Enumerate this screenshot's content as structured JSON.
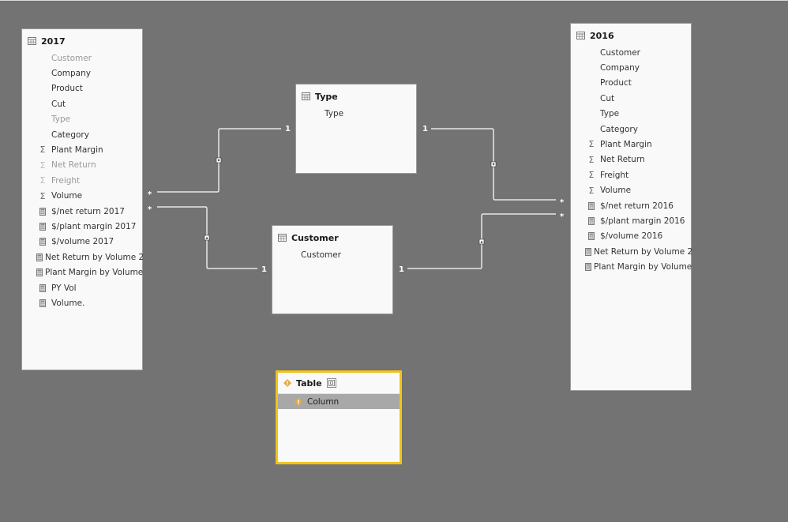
{
  "tables": {
    "t2017": {
      "title": "2017",
      "fields": [
        {
          "label": "Customer",
          "kind": "column",
          "hidden": true
        },
        {
          "label": "Company",
          "kind": "column",
          "hidden": false
        },
        {
          "label": "Product",
          "kind": "column",
          "hidden": false
        },
        {
          "label": "Cut",
          "kind": "column",
          "hidden": false
        },
        {
          "label": "Type",
          "kind": "column",
          "hidden": true
        },
        {
          "label": "Category",
          "kind": "column",
          "hidden": false
        },
        {
          "label": "Plant Margin",
          "kind": "sum",
          "hidden": false
        },
        {
          "label": "Net Return",
          "kind": "sum",
          "hidden": true
        },
        {
          "label": "Freight",
          "kind": "sum",
          "hidden": true
        },
        {
          "label": "Volume",
          "kind": "sum",
          "hidden": false
        },
        {
          "label": "$/net return 2017",
          "kind": "measure",
          "hidden": false
        },
        {
          "label": "$/plant margin 2017",
          "kind": "measure",
          "hidden": false
        },
        {
          "label": "$/volume 2017",
          "kind": "measure",
          "hidden": false
        },
        {
          "label": "Net Return by Volume 2",
          "kind": "measure",
          "hidden": false
        },
        {
          "label": "Plant Margin by Volume",
          "kind": "measure",
          "hidden": false
        },
        {
          "label": "PY Vol",
          "kind": "measure",
          "hidden": false
        },
        {
          "label": "Volume.",
          "kind": "measure",
          "hidden": false
        }
      ]
    },
    "t2016": {
      "title": "2016",
      "fields": [
        {
          "label": "Customer",
          "kind": "column",
          "hidden": false
        },
        {
          "label": "Company",
          "kind": "column",
          "hidden": false
        },
        {
          "label": "Product",
          "kind": "column",
          "hidden": false
        },
        {
          "label": "Cut",
          "kind": "column",
          "hidden": false
        },
        {
          "label": "Type",
          "kind": "column",
          "hidden": false
        },
        {
          "label": "Category",
          "kind": "column",
          "hidden": false
        },
        {
          "label": "Plant Margin",
          "kind": "sum",
          "hidden": false
        },
        {
          "label": "Net Return",
          "kind": "sum",
          "hidden": false
        },
        {
          "label": "Freight",
          "kind": "sum",
          "hidden": false
        },
        {
          "label": "Volume",
          "kind": "sum",
          "hidden": false
        },
        {
          "label": "$/net return 2016",
          "kind": "measure",
          "hidden": false
        },
        {
          "label": "$/plant margin 2016",
          "kind": "measure",
          "hidden": false
        },
        {
          "label": "$/volume 2016",
          "kind": "measure",
          "hidden": false
        },
        {
          "label": "Net Return by Volume 2",
          "kind": "measure",
          "hidden": false
        },
        {
          "label": "Plant Margin by Volume",
          "kind": "measure",
          "hidden": false
        }
      ]
    },
    "type": {
      "title": "Type",
      "fields": [
        {
          "label": "Type"
        }
      ]
    },
    "customer": {
      "title": "Customer",
      "fields": [
        {
          "label": "Customer"
        }
      ]
    },
    "table": {
      "title": "Table",
      "fields": [
        {
          "label": "Column"
        }
      ],
      "status": "error"
    }
  },
  "relationships": [
    {
      "from": "2017",
      "to": "Type",
      "from_card": "*",
      "to_card": "1"
    },
    {
      "from": "2017",
      "to": "Customer",
      "from_card": "*",
      "to_card": "1"
    },
    {
      "from": "2016",
      "to": "Type",
      "from_card": "*",
      "to_card": "1"
    },
    {
      "from": "2016",
      "to": "Customer",
      "from_card": "*",
      "to_card": "1"
    }
  ],
  "labels": {
    "one": "1",
    "many": "*"
  },
  "colors": {
    "canvas": "#737373",
    "card": "#f9f9f9",
    "error_border": "#f0c419",
    "line": "#e6e6e6"
  }
}
